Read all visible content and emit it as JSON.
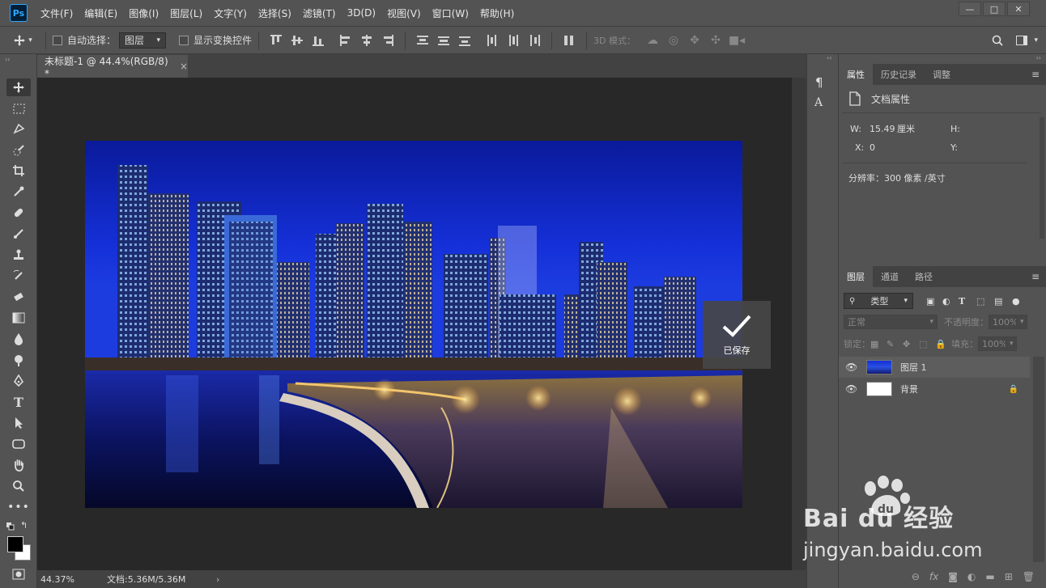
{
  "app": {
    "logo": "Ps"
  },
  "menu": [
    "文件(F)",
    "编辑(E)",
    "图像(I)",
    "图层(L)",
    "文字(Y)",
    "选择(S)",
    "滤镜(T)",
    "3D(D)",
    "视图(V)",
    "窗口(W)",
    "帮助(H)"
  ],
  "window_controls": {
    "minimize": "—",
    "maximize": "□",
    "close": "✕"
  },
  "options_bar": {
    "auto_select_label": "自动选择：",
    "auto_select_target": "图层",
    "show_transform_label": "显示变换控件",
    "mode3d_label": "3D 模式："
  },
  "document": {
    "tab_title": "未标题-1 @ 44.4%(RGB/8) *",
    "close": "×",
    "saved_toast": "已保存",
    "status_zoom": "44.37%",
    "status_doc": "文档:5.36M/5.36M",
    "status_arrow": "›"
  },
  "properties_panel": {
    "tabs": [
      "属性",
      "历史记录",
      "调整"
    ],
    "section_title": "文档属性",
    "w_label": "W:",
    "w_value": "15.49",
    "w_unit": "厘米",
    "h_label": "H:",
    "x_label": "X:",
    "x_value": "0",
    "y_label": "Y:",
    "resolution": "分辨率：300 像素 /英寸"
  },
  "layers_panel": {
    "tabs": [
      "图层",
      "通道",
      "路径"
    ],
    "filter_kind": "类型",
    "blend_mode": "正常",
    "opacity_label": "不透明度：",
    "opacity_value": "100%",
    "lock_label": "锁定：",
    "fill_label": "填充：",
    "fill_value": "100%",
    "layers": [
      {
        "name": "图层 1"
      },
      {
        "name": "背景"
      }
    ]
  },
  "watermark": {
    "brand": "Bai du 经验",
    "url": "jingyan.baidu.com"
  },
  "colors": {
    "ui_bg": "#535353",
    "canvas_bg": "#282828",
    "ps_blue": "#31a8ff"
  }
}
